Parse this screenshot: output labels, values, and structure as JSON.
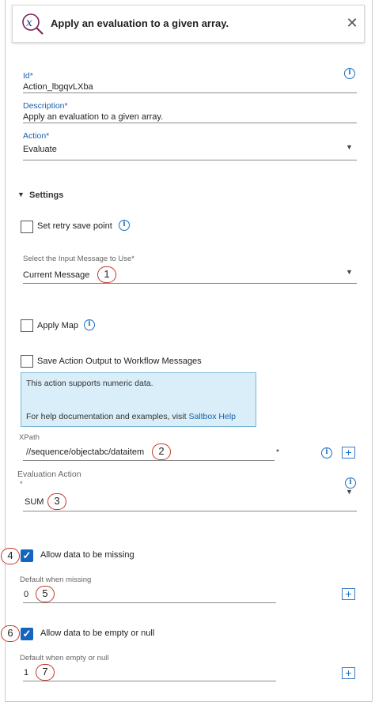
{
  "header": {
    "title": "Apply an evaluation to a given array.",
    "icon": "function-x-icon"
  },
  "id_field": {
    "label": "Id*",
    "value": "Action_lbgqvLXba"
  },
  "description_field": {
    "label": "Description*",
    "value": "Apply an evaluation to a given array."
  },
  "action_field": {
    "label": "Action*",
    "value": "Evaluate"
  },
  "settings": {
    "label": "Settings"
  },
  "retry": {
    "label": "Set retry save point"
  },
  "input_message": {
    "label": "Select the Input Message to Use*",
    "value": "Current Message",
    "callout": "1"
  },
  "apply_map": {
    "label": "Apply Map"
  },
  "save_output": {
    "label": "Save Action Output to Workflow Messages"
  },
  "info_box": {
    "line1": "This action supports numeric data.",
    "line2_prefix": "For help documentation and examples, visit ",
    "link": "Saltbox Help"
  },
  "xpath": {
    "label": "XPath",
    "value": "//sequence/objectabc/dataitem",
    "required_mark": "*",
    "callout": "2"
  },
  "evaluation_action": {
    "label": "Evaluation Action",
    "required_mark": "*",
    "value": "SUM",
    "callout": "3"
  },
  "allow_missing": {
    "label": "Allow data to be missing",
    "checked": true,
    "callout": "4"
  },
  "default_missing": {
    "label": "Default when missing",
    "value": "0",
    "callout": "5"
  },
  "allow_empty": {
    "label": "Allow data to be empty or null",
    "checked": true,
    "callout": "6"
  },
  "default_empty": {
    "label": "Default when empty or null",
    "value": "1",
    "callout": "7"
  },
  "colors": {
    "accent": "#1565c0",
    "callout_border": "#c0392b",
    "infobox_bg": "#d9eef8"
  }
}
